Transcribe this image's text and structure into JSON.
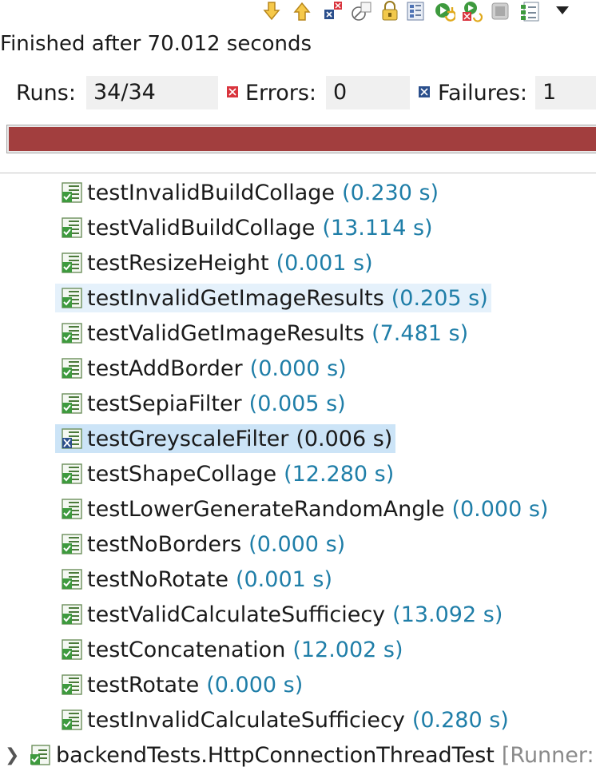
{
  "status": {
    "text": "Finished after 70.012 seconds"
  },
  "counters": {
    "runs_label": "Runs:",
    "runs_value": "34/34",
    "errors_label": "Errors:",
    "errors_value": "0",
    "failures_label": "Failures:",
    "failures_value": "1"
  },
  "progress": {
    "state": "failed",
    "fraction": 1.0,
    "color": "#a23e3e"
  },
  "toolbar": {
    "buttons": [
      "next-failure-icon",
      "previous-failure-icon",
      "show-failures-only-icon",
      "show-skipped-only-icon",
      "scroll-lock-icon",
      "test-hierarchy-icon",
      "rerun-test-icon",
      "rerun-failures-first-icon",
      "stop-icon",
      "test-run-history-icon",
      "view-menu-icon"
    ]
  },
  "tests": [
    {
      "name": "testInvalidBuildCollage",
      "time": "(0.230 s)",
      "status": "passed"
    },
    {
      "name": "testValidBuildCollage",
      "time": "(13.114 s)",
      "status": "passed"
    },
    {
      "name": "testResizeHeight",
      "time": "(0.001 s)",
      "status": "passed"
    },
    {
      "name": "testInvalidGetImageResults",
      "time": "(0.205 s)",
      "status": "passed",
      "highlight": "hover"
    },
    {
      "name": "testValidGetImageResults",
      "time": "(7.481 s)",
      "status": "passed"
    },
    {
      "name": "testAddBorder",
      "time": "(0.000 s)",
      "status": "passed"
    },
    {
      "name": "testSepiaFilter",
      "time": "(0.005 s)",
      "status": "passed"
    },
    {
      "name": "testGreyscaleFilter",
      "time": "(0.006 s)",
      "status": "failed",
      "highlight": "selected"
    },
    {
      "name": "testShapeCollage",
      "time": "(12.280 s)",
      "status": "passed"
    },
    {
      "name": "testLowerGenerateRandomAngle",
      "time": "(0.000 s)",
      "status": "passed"
    },
    {
      "name": "testNoBorders",
      "time": "(0.000 s)",
      "status": "passed"
    },
    {
      "name": "testNoRotate",
      "time": "(0.001 s)",
      "status": "passed"
    },
    {
      "name": "testValidCalculateSufficiecy",
      "time": "(13.092 s)",
      "status": "passed"
    },
    {
      "name": "testConcatenation",
      "time": "(12.002 s)",
      "status": "passed"
    },
    {
      "name": "testRotate",
      "time": "(0.000 s)",
      "status": "passed"
    },
    {
      "name": "testInvalidCalculateSufficiecy",
      "time": "(0.280 s)",
      "status": "passed"
    }
  ],
  "suite": {
    "name": "backendTests.HttpConnectionThreadTest",
    "runner": "[Runner:",
    "status": "passed"
  }
}
